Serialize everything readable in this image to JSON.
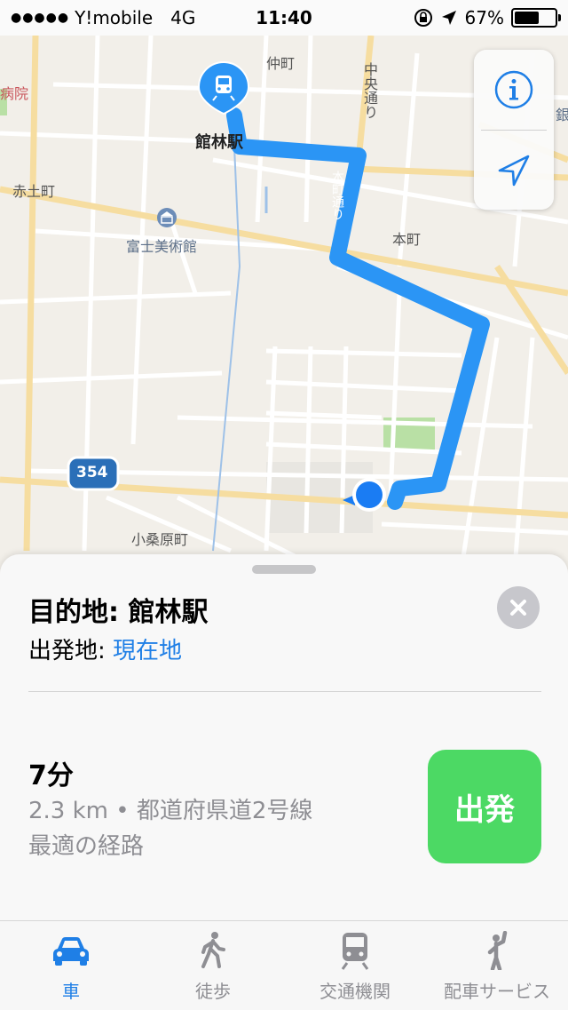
{
  "status_bar": {
    "carrier": "Y!mobile",
    "network": "4G",
    "time": "11:40",
    "battery_percent": "67%",
    "battery_level": 0.67
  },
  "map": {
    "labels": {
      "station": "館林駅",
      "nakamachi": "仲町",
      "chuo_dori": "中央通り",
      "hospital": "病院",
      "akatsuchi": "赤土町",
      "fuji_museum": "富士美術館",
      "honmachi_dori": "本町通り",
      "honmachi": "本町",
      "route_354": "354",
      "kokuwabara": "小桑原町",
      "bank_fragment": "銀"
    },
    "colors": {
      "route": "#2b95f5",
      "location": "#1a7cf3",
      "transit_pin": "#2b95f5"
    }
  },
  "map_controls": {
    "info_icon": "info-icon",
    "location_icon": "location-arrow-icon"
  },
  "route_card": {
    "destination": "目的地: 館林駅",
    "origin_label": "出発地: ",
    "origin_value": "現在地",
    "eta": "7分",
    "distance_road": "2.3 km • 都道府県道2号線",
    "route_note": "最適の経路",
    "go_label": "出発",
    "colors": {
      "go": "#4cd964",
      "link": "#1f7fe6"
    }
  },
  "tabs": [
    {
      "label": "車",
      "icon": "car-icon",
      "active": true
    },
    {
      "label": "徒歩",
      "icon": "walk-icon",
      "active": false
    },
    {
      "label": "交通機関",
      "icon": "train-icon",
      "active": false
    },
    {
      "label": "配車サービス",
      "icon": "ride-share-icon",
      "active": false
    }
  ]
}
